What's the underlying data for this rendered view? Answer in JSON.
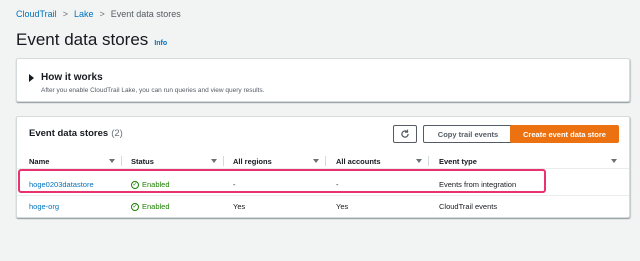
{
  "breadcrumb": {
    "items": [
      "CloudTrail",
      "Lake"
    ],
    "current": "Event data stores"
  },
  "page": {
    "title": "Event data stores",
    "info": "Info"
  },
  "how_it_works": {
    "title": "How it works",
    "description": "After you enable CloudTrail Lake, you can run queries and view query results."
  },
  "table": {
    "title": "Event data stores",
    "count": "(2)",
    "buttons": {
      "refresh_icon": "refresh-icon",
      "copy": "Copy trail events",
      "create": "Create event data store"
    },
    "columns": [
      "Name",
      "Status",
      "All regions",
      "All accounts",
      "Event type"
    ],
    "rows": [
      {
        "name": "hoge0203datastore",
        "status": "Enabled",
        "all_regions": "-",
        "all_accounts": "-",
        "event_type": "Events from integration"
      },
      {
        "name": "hoge-org",
        "status": "Enabled",
        "all_regions": "Yes",
        "all_accounts": "Yes",
        "event_type": "CloudTrail events"
      }
    ]
  },
  "colors": {
    "link": "#0073bb",
    "accent": "#ec7211",
    "success": "#1d8102",
    "highlight": "#e8336e"
  }
}
